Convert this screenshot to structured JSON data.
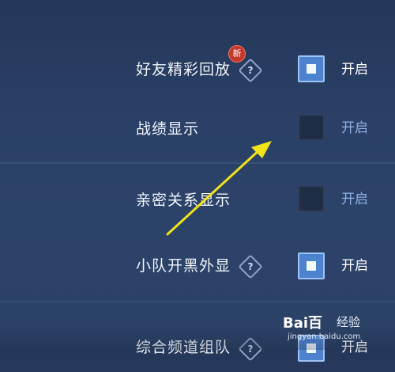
{
  "settings": [
    {
      "label": "好友精彩回放",
      "state": "开启",
      "checked": true,
      "has_help": true,
      "is_new": true
    },
    {
      "label": "战绩显示",
      "state": "开启",
      "checked": false,
      "has_help": false,
      "is_new": false
    },
    {
      "label": "亲密关系显示",
      "state": "开启",
      "checked": false,
      "has_help": false,
      "is_new": false
    },
    {
      "label": "小队开黑外显",
      "state": "开启",
      "checked": true,
      "has_help": true,
      "is_new": false
    },
    {
      "label": "综合频道组队",
      "state": "开启",
      "checked": true,
      "has_help": true,
      "is_new": false
    }
  ],
  "badge": {
    "new_label": "新"
  },
  "help_symbol": "?",
  "icons": {
    "help": "question-diamond-icon",
    "arrow": "yellow-annotation-arrow",
    "checkbox_on": "checkbox-checked-icon",
    "checkbox_off": "checkbox-empty-icon"
  },
  "colors": {
    "background": "#2a4066",
    "checkbox_on": "#4d82cf",
    "checkbox_off": "#1f2d47",
    "state_off_text": "#8fb0e6",
    "annotation_arrow": "#f2e21a",
    "new_badge": "#c5382d"
  },
  "watermark": {
    "logo": "Bai百",
    "text": "经验",
    "url": "jingyan.baidu.com"
  }
}
